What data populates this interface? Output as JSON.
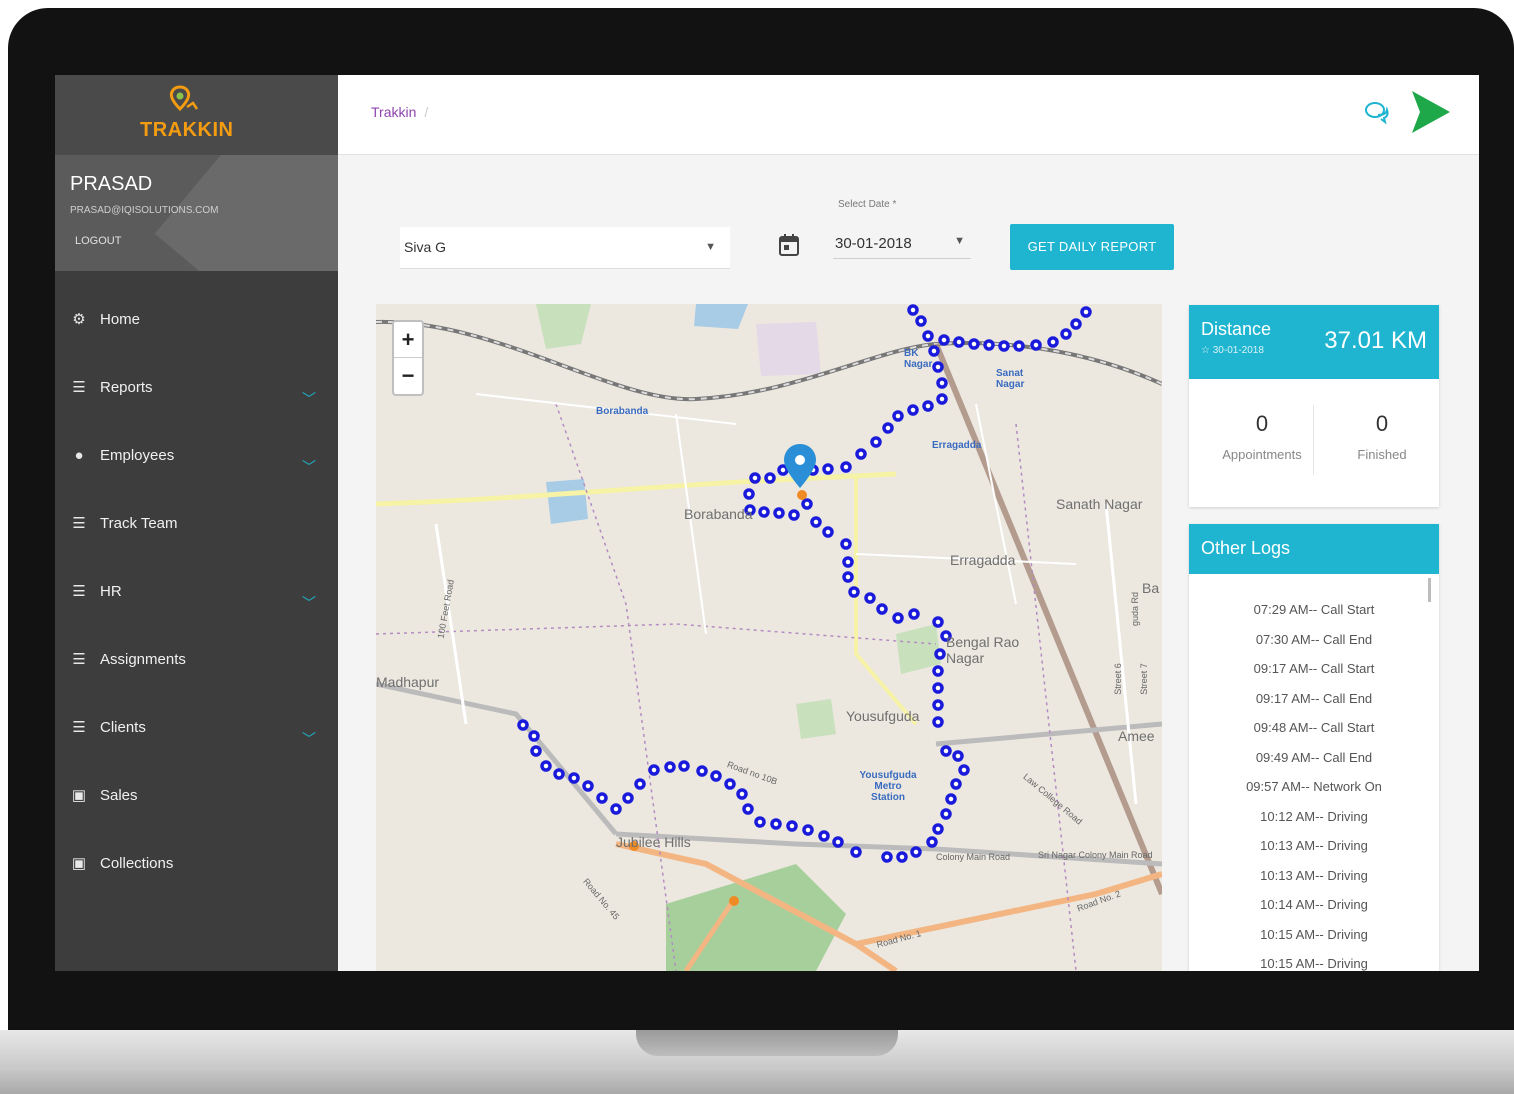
{
  "app": {
    "logo_text": "TRAKKIN",
    "user_name": "PRASAD",
    "user_email": "PRASAD@IQISOLUTIONS.COM",
    "logout_label": "LOGOUT"
  },
  "sidebar": {
    "items": [
      {
        "label": "Home",
        "icon": "gear-icon",
        "has_chevron": false
      },
      {
        "label": "Reports",
        "icon": "list-icon",
        "has_chevron": true
      },
      {
        "label": "Employees",
        "icon": "user-icon",
        "has_chevron": true
      },
      {
        "label": "Track Team",
        "icon": "list-icon",
        "has_chevron": false
      },
      {
        "label": "HR",
        "icon": "list-icon",
        "has_chevron": true
      },
      {
        "label": "Assignments",
        "icon": "list-icon",
        "has_chevron": false
      },
      {
        "label": "Clients",
        "icon": "list-icon",
        "has_chevron": true
      },
      {
        "label": "Sales",
        "icon": "money-icon",
        "has_chevron": false
      },
      {
        "label": "Collections",
        "icon": "money-icon",
        "has_chevron": false
      }
    ]
  },
  "header": {
    "breadcrumb": "Trakkin",
    "breadcrumb_sep": "/"
  },
  "filters": {
    "employee": "Siva G",
    "date_label": "Select Date *",
    "date_value": "30-01-2018",
    "report_button": "GET DAILY REPORT"
  },
  "map": {
    "zoom_in": "+",
    "zoom_out": "−",
    "labels": {
      "borabanda_small": "Borabanda",
      "borabanda": "Borabanda",
      "sanat_nagar_small": "Sanat Nagar",
      "sanath_nagar": "Sanath Nagar",
      "erragadda_small": "Erragadda",
      "erragadda": "Erragadda",
      "bk_nagar": "BK Nagar",
      "bengal_rao": "Bengal Rao Nagar",
      "yousufguda": "Yousufguda",
      "yousufguda_metro": "Yousufguda Metro Station",
      "madhapur": "Madhapur",
      "jubilee_hills": "Jubilee Hills",
      "ameerpet": "Amee",
      "feet_road": "100 Feet Road",
      "road_no_10b": "Road no 10B",
      "sri_nagar": "Sri Nagar Colony Main Road",
      "colony_main": "Colony Main Road",
      "road_no_45": "Road No. 45",
      "road_no_2": "Road No. 2",
      "road_no_1": "Road No. 1",
      "street_6": "Street 6",
      "street_7": "Street 7",
      "guda_rd": "guda Rd",
      "law_college": "Law College Road",
      "ba": "Ba"
    }
  },
  "stats": {
    "distance_label": "Distance",
    "distance_date": "☆ 30-01-2018",
    "distance_value": "37.01 KM",
    "appointments_count": "0",
    "appointments_label": "Appointments",
    "finished_count": "0",
    "finished_label": "Finished"
  },
  "logs": {
    "title": "Other Logs",
    "entries": [
      "07:29 AM-- Call Start",
      "07:30 AM-- Call End",
      "09:17 AM-- Call Start",
      "09:17 AM-- Call End",
      "09:48 AM-- Call Start",
      "09:49 AM-- Call End",
      "09:57 AM-- Network On",
      "10:12 AM-- Driving",
      "10:13 AM-- Driving",
      "10:13 AM-- Driving",
      "10:14 AM-- Driving",
      "10:15 AM-- Driving",
      "10:15 AM-- Driving"
    ]
  },
  "colors": {
    "accent": "#1fb5d0",
    "sidebar": "#3d3d3d",
    "route": "#1a1adb",
    "breadcrumb": "#8e44ad",
    "send_icon": "#1fa84a"
  }
}
